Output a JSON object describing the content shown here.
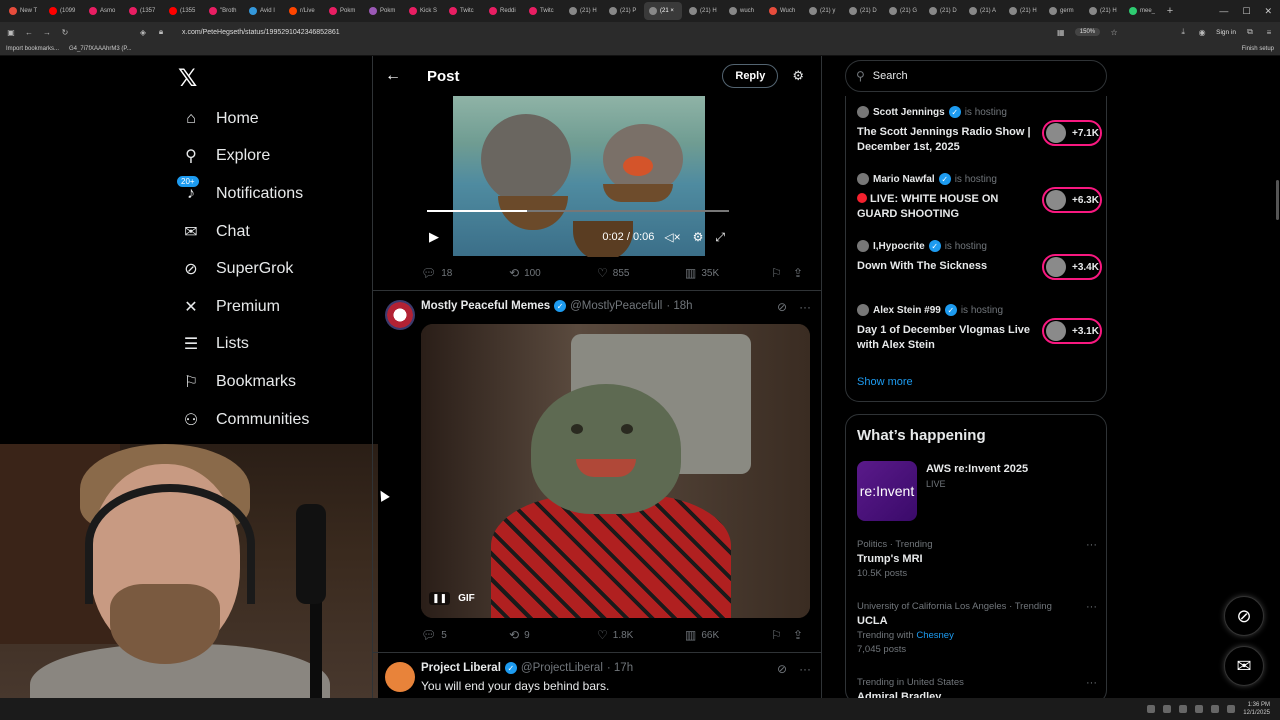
{
  "browser": {
    "tabs": [
      {
        "label": "New T",
        "color": "#e74c3c"
      },
      {
        "label": "(1099",
        "color": "#ff0000"
      },
      {
        "label": "Asmo",
        "color": "#e91e63"
      },
      {
        "label": "(1357",
        "color": "#e91e63"
      },
      {
        "label": "(1355",
        "color": "#ff0000"
      },
      {
        "label": "\"Broth",
        "color": "#e91e63"
      },
      {
        "label": "Avid I",
        "color": "#3498db"
      },
      {
        "label": "r/Live",
        "color": "#ff4500"
      },
      {
        "label": "Pokm",
        "color": "#e91e63"
      },
      {
        "label": "Pokm",
        "color": "#9b59b6"
      },
      {
        "label": "Kick S",
        "color": "#e91e63"
      },
      {
        "label": "Twitc",
        "color": "#e91e63"
      },
      {
        "label": "Reddi",
        "color": "#e91e63"
      },
      {
        "label": "Twitc",
        "color": "#e91e63"
      },
      {
        "label": "(21) H",
        "color": "#888888"
      },
      {
        "label": "(21) P",
        "color": "#888888"
      },
      {
        "label": "(21 ×",
        "color": "#888888"
      },
      {
        "label": "(21) H",
        "color": "#888888"
      },
      {
        "label": "wuch",
        "color": "#888888"
      },
      {
        "label": "Wuch",
        "color": "#e74c3c"
      },
      {
        "label": "(21) y",
        "color": "#888888"
      },
      {
        "label": "(21) D",
        "color": "#888888"
      },
      {
        "label": "(21) G",
        "color": "#888888"
      },
      {
        "label": "(21) D",
        "color": "#888888"
      },
      {
        "label": "(21) A",
        "color": "#888888"
      },
      {
        "label": "(21) H",
        "color": "#888888"
      },
      {
        "label": "germ",
        "color": "#888888"
      },
      {
        "label": "(21) H",
        "color": "#888888"
      },
      {
        "label": "mee_",
        "color": "#2ecc71"
      }
    ],
    "active_tab_index": 16,
    "url": "x.com/PeteHegseth/status/1995291042346852861",
    "zoom": "150%",
    "sign_in": "Sign in",
    "bookmarks": [
      "Import bookmarks...",
      "G4_7i7fXAAAhrM3 (P..."
    ],
    "finish_setup": "Finish setup"
  },
  "nav": {
    "items": [
      {
        "label": "Home",
        "icon": "home-icon",
        "glyph": "⌂"
      },
      {
        "label": "Explore",
        "icon": "search-icon",
        "glyph": "⚲"
      },
      {
        "label": "Notifications",
        "icon": "bell-icon",
        "glyph": "♪",
        "badge": "20+"
      },
      {
        "label": "Chat",
        "icon": "mail-icon",
        "glyph": "✉"
      },
      {
        "label": "SuperGrok",
        "icon": "grok-icon",
        "glyph": "⊘"
      },
      {
        "label": "Premium",
        "icon": "x-logo-icon",
        "glyph": "✕"
      },
      {
        "label": "Lists",
        "icon": "list-icon",
        "glyph": "☰"
      },
      {
        "label": "Bookmarks",
        "icon": "bookmark-icon",
        "glyph": "⚐"
      },
      {
        "label": "Communities",
        "icon": "people-icon",
        "glyph": "⚇"
      }
    ]
  },
  "header": {
    "title": "Post",
    "reply": "Reply"
  },
  "post1": {
    "time": "0:02 / 0:06",
    "progress": 0.33,
    "stats": {
      "replies": "18",
      "reposts": "100",
      "likes": "855",
      "views": "35K"
    }
  },
  "post2": {
    "author": "Mostly Peaceful Memes",
    "handle": "@MostlyPeacefull",
    "time": "· 18h",
    "gif_label": "GIF",
    "stats": {
      "replies": "5",
      "reposts": "9",
      "likes": "1.8K",
      "views": "66K"
    }
  },
  "post3": {
    "author": "Project Liberal",
    "handle": "@ProjectLiberal",
    "time": "· 17h",
    "text": "You will end your days behind bars."
  },
  "search": {
    "placeholder": "Search"
  },
  "spaces": [
    {
      "host": "Scott Jennings",
      "status": "is hosting",
      "title": "The Scott Jennings Radio Show | December 1st, 2025",
      "count": "+7.1K",
      "live": false
    },
    {
      "host": "Mario Nawfal",
      "status": "is hosting",
      "title": "LIVE: WHITE HOUSE ON GUARD SHOOTING",
      "count": "+6.3K",
      "live": true
    },
    {
      "host": "I,Hypocrite",
      "status": "is hosting",
      "title": "Down With The Sickness",
      "count": "+3.4K",
      "live": false
    },
    {
      "host": "Alex Stein #99",
      "status": "is hosting",
      "title": "Day 1 of December Vlogmas Live with Alex Stein",
      "count": "+3.1K",
      "live": false
    }
  ],
  "show_more": "Show more",
  "happening": {
    "title": "What’s happening",
    "featured": {
      "title": "AWS re:Invent 2025",
      "status": "LIVE",
      "thumb_text": "re:Invent"
    },
    "trends": [
      {
        "category": "Politics · Trending",
        "name": "Trump's MRI",
        "count": "10.5K posts"
      },
      {
        "category": "University of California Los Angeles · Trending",
        "name": "UCLA",
        "with_label": "Trending with",
        "with_link": "Chesney",
        "count": "7,045 posts"
      },
      {
        "category": "Trending in United States",
        "name": "Admiral Bradley",
        "count": ""
      }
    ]
  },
  "taskbar": {
    "time": "1:36 PM",
    "date": "12/1/2025"
  }
}
